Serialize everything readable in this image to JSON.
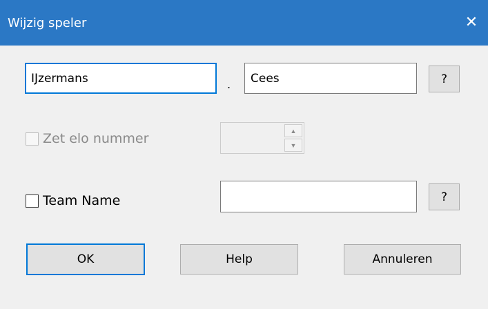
{
  "window": {
    "title": "Wijzig speler",
    "close_glyph": "✕"
  },
  "name": {
    "last_name": "IJzermans",
    "separator": ".",
    "first_name": "Cees",
    "lookup_label": "?"
  },
  "elo": {
    "checkbox_label": "Zet elo nummer",
    "checked": false,
    "enabled": false,
    "value": ""
  },
  "team": {
    "checkbox_label": "Team Name",
    "checked": false,
    "value": "",
    "lookup_label": "?"
  },
  "buttons": {
    "ok": "OK",
    "help": "Help",
    "cancel": "Annuleren"
  },
  "colors": {
    "titlebar": "#2b78c5",
    "focus": "#0078d7",
    "dialog_bg": "#f0f0f0"
  }
}
